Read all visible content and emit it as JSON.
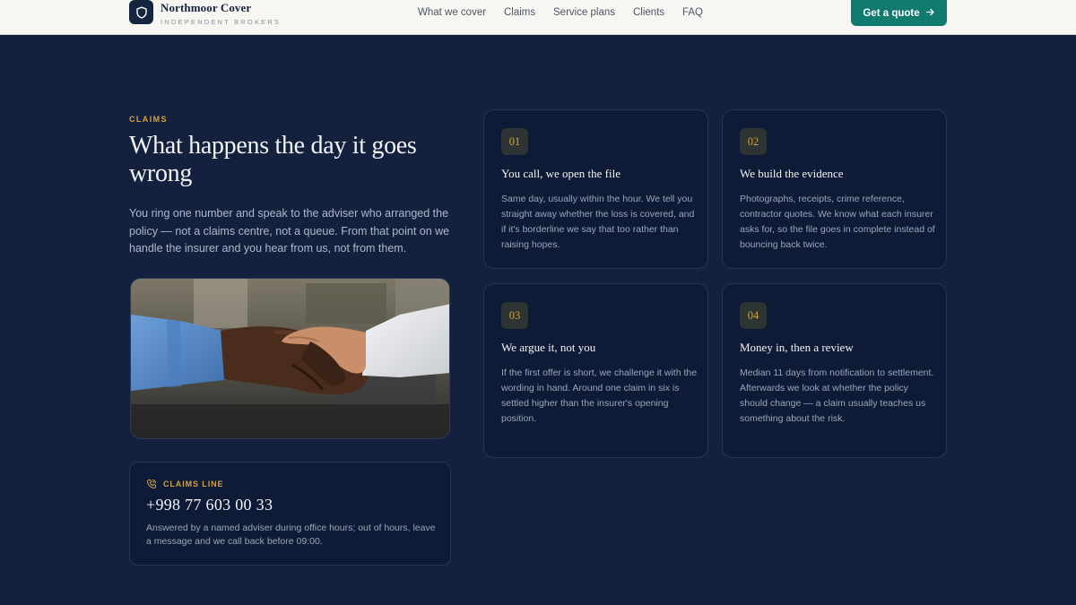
{
  "header": {
    "brand_name": "Northmoor Cover",
    "brand_tagline": "INDEPENDENT BROKERS",
    "nav": [
      "What we cover",
      "Claims",
      "Service plans",
      "Clients",
      "FAQ"
    ],
    "cta_label": "Get a quote",
    "cta_icon": "arrow-right-icon"
  },
  "section": {
    "eyebrow": "CLAIMS",
    "heading": "What happens the day it goes wrong",
    "intro": "You ring one number and speak to the adviser who arranged the policy — not a claims centre, not a queue. From that point on we handle the insurer and you hear from us, not from them."
  },
  "claims_line": {
    "label": "CLAIMS LINE",
    "icon": "phone-icon",
    "number": "+998 77 603 00 33",
    "note": "Answered by a named adviser during office hours; out of hours, leave a message and we call back before 09:00."
  },
  "steps": [
    {
      "num": "01",
      "title": "You call, we open the file",
      "body": "Same day, usually within the hour. We tell you straight away whether the loss is covered, and if it's borderline we say that too rather than raising hopes."
    },
    {
      "num": "02",
      "title": "We build the evidence",
      "body": "Photographs, receipts, crime reference, contractor quotes. We know what each insurer asks for, so the file goes in complete instead of bouncing back twice."
    },
    {
      "num": "03",
      "title": "We argue it, not you",
      "body": "If the first offer is short, we challenge it with the wording in hand. Around one claim in six is settled higher than the insurer's opening position."
    },
    {
      "num": "04",
      "title": "Money in, then a review",
      "body": "Median 11 days from notification to settlement. Afterwards we look at whether the policy should change — a claim usually teaches us something about the risk."
    }
  ],
  "colors": {
    "page_bg": "#13213f",
    "header_bg": "#f7f6f2",
    "accent_gold": "#d3a03f",
    "cta_teal": "#117a6e",
    "card_bg": "#0e1b36"
  }
}
